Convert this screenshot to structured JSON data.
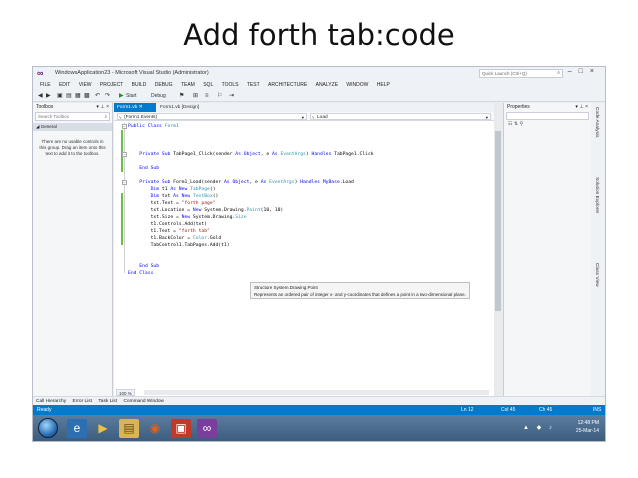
{
  "slide": {
    "title": "Add forth tab:code"
  },
  "window": {
    "title": "WindowsApplication23 - Microsoft Visual Studio (Administrator)",
    "quick_launch_placeholder": "Quick Launch (Ctrl+Q)"
  },
  "menu": [
    "FILE",
    "EDIT",
    "VIEW",
    "PROJECT",
    "BUILD",
    "DEBUG",
    "TEAM",
    "SQL",
    "TOOLS",
    "TEST",
    "ARCHITECTURE",
    "ANALYZE",
    "WINDOW",
    "HELP"
  ],
  "toolbar": {
    "start_label": "Start",
    "config": "Debug"
  },
  "toolbox": {
    "title": "Toolbox",
    "search_placeholder": "Search Toolbox",
    "group": "General",
    "empty_message": "There are no usable controls in this group. Drag an item onto this text to add it to the toolbox."
  },
  "editor": {
    "tabs": [
      {
        "label": "Form1.vb",
        "active": true
      },
      {
        "label": "Form1.vb [Design]",
        "active": false
      }
    ],
    "nav_left": "(Form1 Events)",
    "nav_right": "Load",
    "zoom": "100 %",
    "tooltip_line1": "Structure System.Drawing.Point",
    "tooltip_line2": "Represents an ordered pair of integer x- and y-coordinates that defines a point in a two-dimensional plane."
  },
  "code_lines": [
    "Public Class Form1",
    "",
    "    Private Sub TabPage1_Click(sender As Object, e As EventArgs) Handles TabPage1.Click",
    "",
    "    End Sub",
    "",
    "    Private Sub Form1_Load(sender As Object, e As EventArgs) Handles MyBase.Load",
    "        Dim t1 As New TabPage()",
    "        Dim txt As New TextBox()",
    "        txt.Text = \"forth page\"",
    "        txt.Location = New System.Drawing.Point(10, 10)",
    "        txt.Size = New System.Drawing.Size",
    "        t1.Controls.Add(txt)",
    "        t1.Text = \"forth tab\"",
    "        t1.BackColor = Color.Gold",
    "        TabControl1.TabPages.Add(t1)",
    "",
    "",
    "    End Sub",
    "End Class"
  ],
  "properties": {
    "title": "Properties"
  },
  "side_tabs": [
    "Code Analysis",
    "Solution Explorer",
    "Class View"
  ],
  "bottom_tabs": [
    "Call Hierarchy",
    "Error List",
    "Task List",
    "Command Window"
  ],
  "status": {
    "ready": "Ready",
    "ln": "Ln 12",
    "col": "Col 45",
    "ch": "Ch 45",
    "ins": "INS"
  },
  "tray": {
    "time": "12:48 PM",
    "date": "25-Mar-14"
  },
  "colors": {
    "accent": "#007acc",
    "keyword": "#0000ff",
    "type": "#2b91af",
    "string": "#a31515"
  }
}
